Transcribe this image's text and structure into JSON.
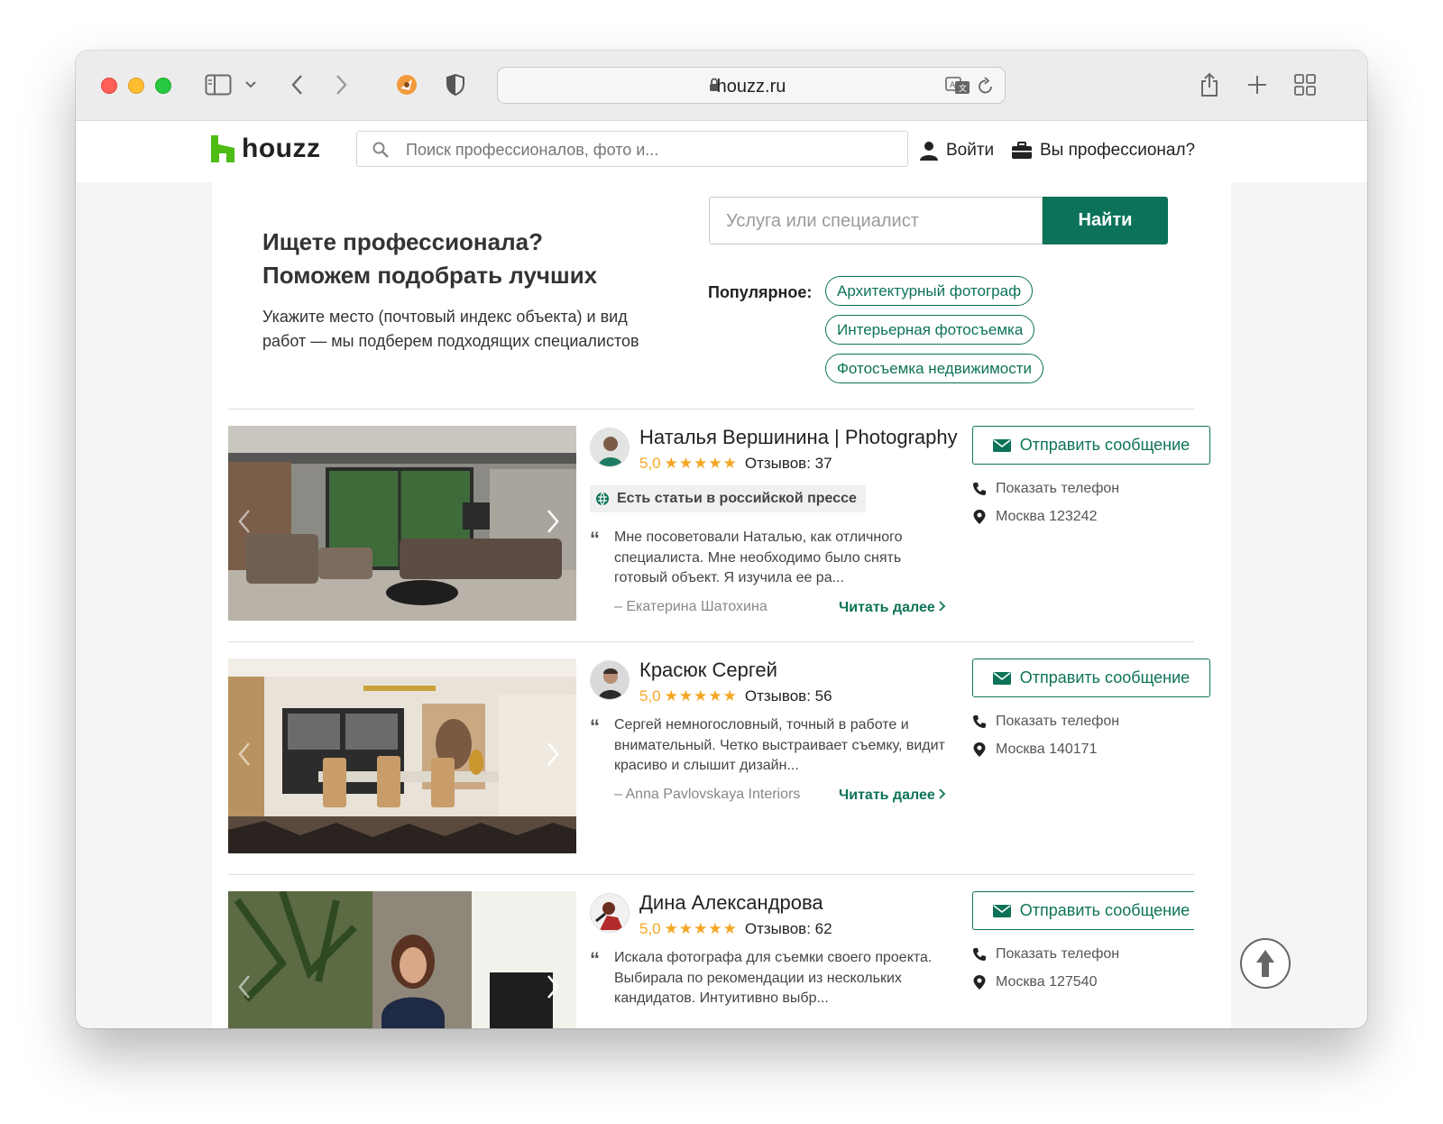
{
  "browser": {
    "url": "houzz.ru"
  },
  "header": {
    "logo_text": "houzz",
    "search_placeholder": "Поиск профессионалов, фото и...",
    "login_label": "Войти",
    "pro_label": "Вы профессионал?"
  },
  "hero": {
    "title_line1": "Ищете профессионала?",
    "title_line2": "Поможем подобрать лучших",
    "subtitle": "Укажите место (почтовый индекс объекта) и вид работ — мы подберем подходящих специалистов",
    "service_placeholder": "Услуга или специалист",
    "find_button": "Найти",
    "popular_label": "Популярное:",
    "popular_chips": [
      "Архитектурный фотограф",
      "Интерьерная фотосъемка",
      "Фотосъемка недвижимости"
    ]
  },
  "pros": [
    {
      "name": "Наталья Вершинина | Photography",
      "rating": "5,0",
      "stars": "★★★★★",
      "reviews": "Отзывов: 37",
      "badge": "Есть статьи в российской прессе",
      "quote": "Мне посоветовали Наталью, как отличного специалиста. Мне необходимо было снять готовый объект. Я изучила ее ра...",
      "author": "– Екатерина Шатохина",
      "read_more": "Читать далее",
      "message_button": "Отправить сообщение",
      "phone_label": "Показать телефон",
      "location": "Москва 123242"
    },
    {
      "name": "Красюк Сергей",
      "rating": "5,0",
      "stars": "★★★★★",
      "reviews": "Отзывов: 56",
      "quote": "Сергей немногословный, точный в работе и внимательный. Четко выстраивает съемку, видит красиво и слышит дизайн...",
      "author": "– Anna Pavlovskaya Interiors",
      "read_more": "Читать далее",
      "message_button": "Отправить сообщение",
      "phone_label": "Показать телефон",
      "location": "Москва 140171"
    },
    {
      "name": "Дина Александрова",
      "rating": "5,0",
      "stars": "★★★★★",
      "reviews": "Отзывов: 62",
      "quote": "Искала фотографа для съемки своего проекта. Выбирала по рекомендации из нескольких кандидатов. Интуитивно выбр...",
      "message_button": "Отправить сообщение",
      "phone_label": "Показать телефон",
      "location": "Москва 127540"
    }
  ],
  "colors": {
    "brand_green": "#0d7358",
    "logo_green": "#4dbc15",
    "star_orange": "#f5a623"
  }
}
